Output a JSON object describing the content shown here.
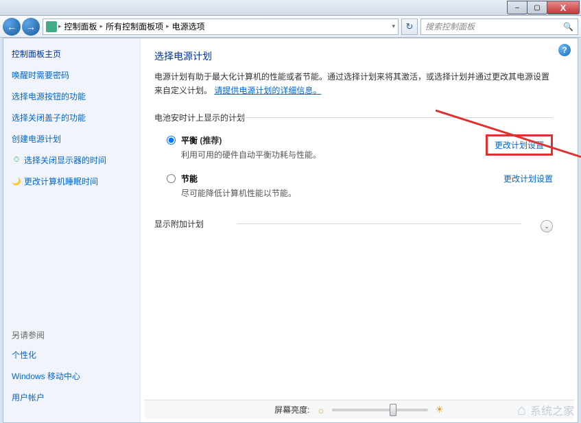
{
  "titlebar": {
    "min": "–",
    "max": "▢",
    "close": "X"
  },
  "nav": {
    "crumbs": [
      "控制面板",
      "所有控制面板项",
      "电源选项"
    ],
    "sep": "▸",
    "dropdown": "▾",
    "refresh": "↻",
    "search_placeholder": "搜索控制面板",
    "mag": "🔍"
  },
  "sidebar": {
    "heading": "控制面板主页",
    "links": [
      {
        "label": "唤醒时需要密码"
      },
      {
        "label": "选择电源按钮的功能"
      },
      {
        "label": "选择关闭盖子的功能"
      },
      {
        "label": "创建电源计划"
      },
      {
        "label": "选择关闭显示器的时间",
        "icon": "⏱"
      },
      {
        "label": "更改计算机睡眠时间",
        "icon": "🌙"
      }
    ],
    "also_heading": "另请参阅",
    "also": [
      "个性化",
      "Windows 移动中心",
      "用户帐户"
    ]
  },
  "main": {
    "title": "选择电源计划",
    "desc_part1": "电源计划有助于最大化计算机的性能或者节能。通过选择计划来将其激活，或选择计划并通过更改其电源设置来自定义计划。",
    "desc_link": "请提供电源计划的详细信息。",
    "section1": "电池安时计上显示的计划",
    "plans": [
      {
        "name": "平衡",
        "rec": " (推荐)",
        "sub": "利用可用的硬件自动平衡功耗与性能。",
        "checked": true
      },
      {
        "name": "节能",
        "rec": "",
        "sub": "尽可能降低计算机性能以节能。",
        "checked": false
      }
    ],
    "change_label": "更改计划设置",
    "section2": "显示附加计划",
    "expand_icon": "⌄",
    "help": "?",
    "brightness_label": "屏幕亮度:",
    "sun_dim": "☼",
    "sun_bright": "☀"
  },
  "watermark": "系统之家"
}
